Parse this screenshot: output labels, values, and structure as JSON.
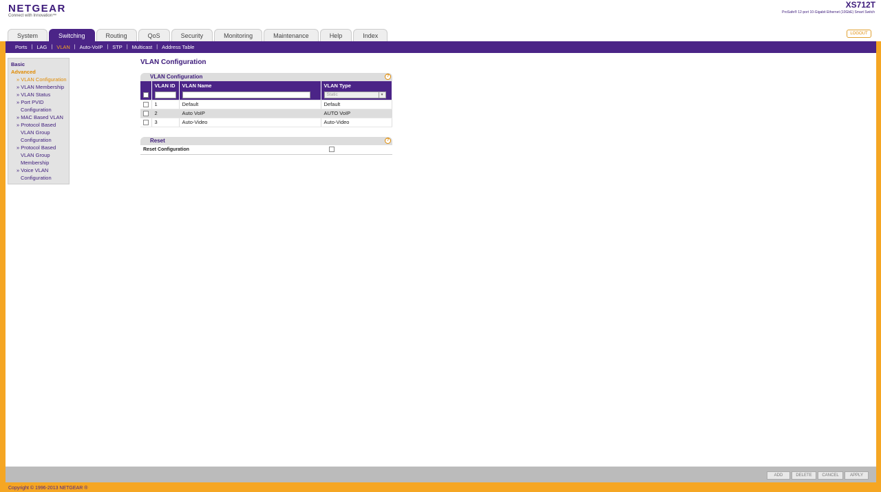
{
  "header": {
    "logo": "NETGEAR",
    "tagline": "Connect with Innovation™",
    "model": "XS712T",
    "model_desc": "ProSafe® 12-port 10-Gigabit Ethernet (10GbE) Smart Switch",
    "logout_label": "LOGOUT"
  },
  "tabs": [
    "System",
    "Switching",
    "Routing",
    "QoS",
    "Security",
    "Monitoring",
    "Maintenance",
    "Help",
    "Index"
  ],
  "subnav": [
    "Ports",
    "LAG",
    "VLAN",
    "Auto-VoIP",
    "STP",
    "Multicast",
    "Address Table"
  ],
  "leftmenu": {
    "basic": "Basic",
    "advanced": "Advanced",
    "items": [
      "» VLAN Configuration",
      "» VLAN Membership",
      "» VLAN Status",
      "» Port PVID",
      "Configuration",
      "» MAC Based VLAN",
      "» Protocol Based",
      "VLAN Group",
      "Configuration",
      "» Protocol Based",
      "VLAN Group",
      "Membership",
      "» Voice VLAN",
      "Configuration"
    ]
  },
  "page_title": "VLAN Configuration",
  "vlan_panel": {
    "title": "VLAN Configuration",
    "help": "?",
    "columns": [
      "VLAN ID",
      "VLAN Name",
      "VLAN Type"
    ],
    "type_select_value": "Static",
    "rows": [
      {
        "id": "1",
        "name": "Default",
        "type": "Default"
      },
      {
        "id": "2",
        "name": "Auto VoIP",
        "type": "AUTO VoIP"
      },
      {
        "id": "3",
        "name": "Auto-Video",
        "type": "Auto-Video"
      }
    ]
  },
  "reset_panel": {
    "title": "Reset",
    "help": "?",
    "label": "Reset Configuration"
  },
  "buttons": {
    "add": "ADD",
    "delete": "DELETE",
    "cancel": "CANCEL",
    "apply": "APPLY"
  },
  "footer": "Copyright © 1996-2013 NETGEAR ®"
}
